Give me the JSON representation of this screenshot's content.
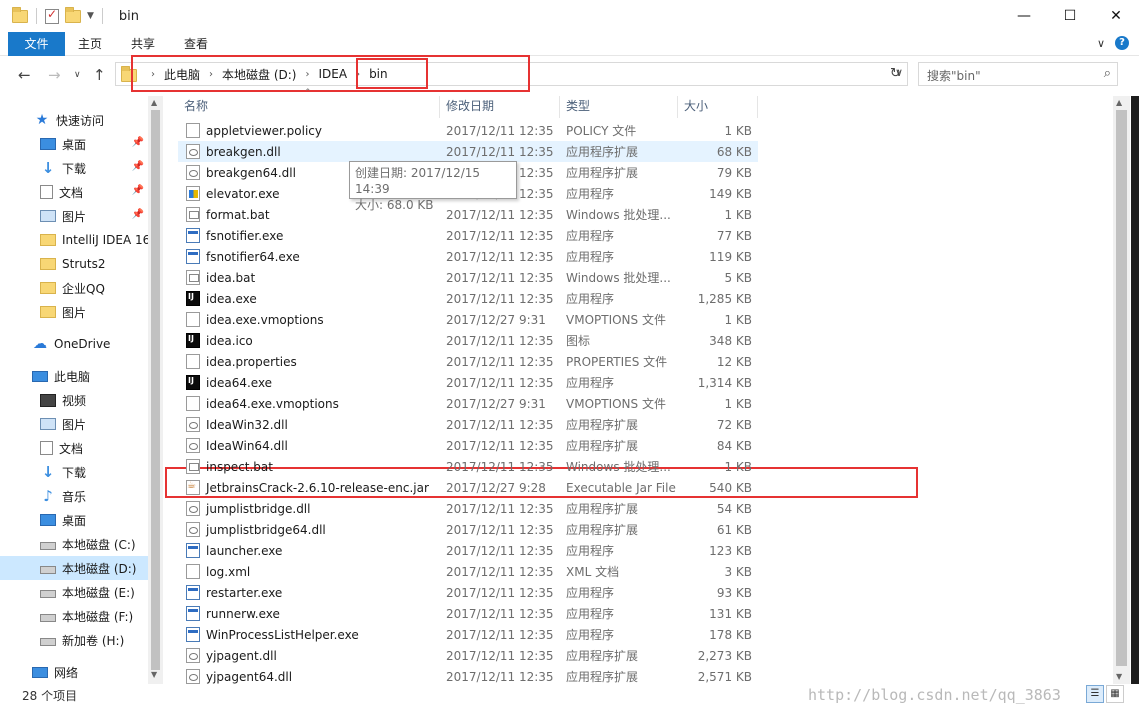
{
  "window": {
    "title": "bin",
    "minimize": "—",
    "maximize": "☐",
    "close": "✕"
  },
  "ribbon": {
    "tabs": [
      "文件",
      "主页",
      "共享",
      "查看"
    ],
    "expand_icon": "chevron-down-icon",
    "help": "?"
  },
  "address": {
    "crumbs": [
      "此电脑",
      "本地磁盘 (D:)",
      "IDEA",
      "bin"
    ],
    "search_placeholder": "搜索\"bin\""
  },
  "sidebar": {
    "items": [
      {
        "label": "快速访问",
        "icon": "star-icon",
        "pinned": false
      },
      {
        "label": "桌面",
        "icon": "desktop-icon",
        "pinned": true
      },
      {
        "label": "下载",
        "icon": "download-icon",
        "pinned": true
      },
      {
        "label": "文档",
        "icon": "document-icon",
        "pinned": true
      },
      {
        "label": "图片",
        "icon": "pictures-icon",
        "pinned": true
      },
      {
        "label": "IntelliJ IDEA 16",
        "icon": "folder-icon",
        "pinned": false
      },
      {
        "label": "Struts2",
        "icon": "folder-icon",
        "pinned": false
      },
      {
        "label": "企业QQ",
        "icon": "folder-icon",
        "pinned": false
      },
      {
        "label": "图片",
        "icon": "folder-icon",
        "pinned": false
      },
      {
        "label": "OneDrive",
        "icon": "cloud-icon",
        "pinned": false
      },
      {
        "label": "此电脑",
        "icon": "computer-icon",
        "pinned": false
      },
      {
        "label": "视频",
        "icon": "video-icon",
        "pinned": false
      },
      {
        "label": "图片",
        "icon": "pictures-icon",
        "pinned": false
      },
      {
        "label": "文档",
        "icon": "document-icon",
        "pinned": false
      },
      {
        "label": "下载",
        "icon": "download-icon",
        "pinned": false
      },
      {
        "label": "音乐",
        "icon": "music-icon",
        "pinned": false
      },
      {
        "label": "桌面",
        "icon": "desktop-icon",
        "pinned": false
      },
      {
        "label": "本地磁盘 (C:)",
        "icon": "drive-icon",
        "pinned": false
      },
      {
        "label": "本地磁盘 (D:)",
        "icon": "drive-icon",
        "pinned": false,
        "selected": true
      },
      {
        "label": "本地磁盘 (E:)",
        "icon": "drive-icon",
        "pinned": false
      },
      {
        "label": "本地磁盘 (F:)",
        "icon": "drive-icon",
        "pinned": false
      },
      {
        "label": "新加卷 (H:)",
        "icon": "drive-icon",
        "pinned": false
      },
      {
        "label": "网络",
        "icon": "network-icon",
        "pinned": false
      }
    ]
  },
  "columns": {
    "name": "名称",
    "date": "修改日期",
    "type": "类型",
    "size": "大小"
  },
  "files": [
    {
      "name": "appletviewer.policy",
      "date": "2017/12/11 12:35",
      "type": "POLICY 文件",
      "size": "1 KB",
      "icon": "file"
    },
    {
      "name": "breakgen.dll",
      "date": "2017/12/11 12:35",
      "type": "应用程序扩展",
      "size": "68 KB",
      "icon": "dll",
      "hover": true
    },
    {
      "name": "breakgen64.dll",
      "date": "2017/12/11 12:35",
      "type": "应用程序扩展",
      "size": "79 KB",
      "icon": "dll"
    },
    {
      "name": "elevator.exe",
      "date": "2017/12/11 12:35",
      "type": "应用程序",
      "size": "149 KB",
      "icon": "elev"
    },
    {
      "name": "format.bat",
      "date": "2017/12/11 12:35",
      "type": "Windows 批处理...",
      "size": "1 KB",
      "icon": "bat"
    },
    {
      "name": "fsnotifier.exe",
      "date": "2017/12/11 12:35",
      "type": "应用程序",
      "size": "77 KB",
      "icon": "exe"
    },
    {
      "name": "fsnotifier64.exe",
      "date": "2017/12/11 12:35",
      "type": "应用程序",
      "size": "119 KB",
      "icon": "exe"
    },
    {
      "name": "idea.bat",
      "date": "2017/12/11 12:35",
      "type": "Windows 批处理...",
      "size": "5 KB",
      "icon": "bat"
    },
    {
      "name": "idea.exe",
      "date": "2017/12/11 12:35",
      "type": "应用程序",
      "size": "1,285 KB",
      "icon": "ij"
    },
    {
      "name": "idea.exe.vmoptions",
      "date": "2017/12/27 9:31",
      "type": "VMOPTIONS 文件",
      "size": "1 KB",
      "icon": "file"
    },
    {
      "name": "idea.ico",
      "date": "2017/12/11 12:35",
      "type": "图标",
      "size": "348 KB",
      "icon": "ij"
    },
    {
      "name": "idea.properties",
      "date": "2017/12/11 12:35",
      "type": "PROPERTIES 文件",
      "size": "12 KB",
      "icon": "file"
    },
    {
      "name": "idea64.exe",
      "date": "2017/12/11 12:35",
      "type": "应用程序",
      "size": "1,314 KB",
      "icon": "ij"
    },
    {
      "name": "idea64.exe.vmoptions",
      "date": "2017/12/27 9:31",
      "type": "VMOPTIONS 文件",
      "size": "1 KB",
      "icon": "file"
    },
    {
      "name": "IdeaWin32.dll",
      "date": "2017/12/11 12:35",
      "type": "应用程序扩展",
      "size": "72 KB",
      "icon": "dll"
    },
    {
      "name": "IdeaWin64.dll",
      "date": "2017/12/11 12:35",
      "type": "应用程序扩展",
      "size": "84 KB",
      "icon": "dll"
    },
    {
      "name": "inspect.bat",
      "date": "2017/12/11 12:35",
      "type": "Windows 批处理...",
      "size": "1 KB",
      "icon": "bat"
    },
    {
      "name": "JetbrainsCrack-2.6.10-release-enc.jar",
      "date": "2017/12/27 9:28",
      "type": "Executable Jar File",
      "size": "540 KB",
      "icon": "jar"
    },
    {
      "name": "jumplistbridge.dll",
      "date": "2017/12/11 12:35",
      "type": "应用程序扩展",
      "size": "54 KB",
      "icon": "dll"
    },
    {
      "name": "jumplistbridge64.dll",
      "date": "2017/12/11 12:35",
      "type": "应用程序扩展",
      "size": "61 KB",
      "icon": "dll"
    },
    {
      "name": "launcher.exe",
      "date": "2017/12/11 12:35",
      "type": "应用程序",
      "size": "123 KB",
      "icon": "exe"
    },
    {
      "name": "log.xml",
      "date": "2017/12/11 12:35",
      "type": "XML 文档",
      "size": "3 KB",
      "icon": "file"
    },
    {
      "name": "restarter.exe",
      "date": "2017/12/11 12:35",
      "type": "应用程序",
      "size": "93 KB",
      "icon": "exe"
    },
    {
      "name": "runnerw.exe",
      "date": "2017/12/11 12:35",
      "type": "应用程序",
      "size": "131 KB",
      "icon": "exe"
    },
    {
      "name": "WinProcessListHelper.exe",
      "date": "2017/12/11 12:35",
      "type": "应用程序",
      "size": "178 KB",
      "icon": "exe"
    },
    {
      "name": "yjpagent.dll",
      "date": "2017/12/11 12:35",
      "type": "应用程序扩展",
      "size": "2,273 KB",
      "icon": "dll"
    },
    {
      "name": "yjpagent64.dll",
      "date": "2017/12/11 12:35",
      "type": "应用程序扩展",
      "size": "2,571 KB",
      "icon": "dll"
    }
  ],
  "tooltip": {
    "created": "创建日期: 2017/12/15 14:39",
    "size": "大小: 68.0 KB"
  },
  "status": {
    "count": "28 个项目"
  },
  "watermark": "http://blog.csdn.net/qq_3863",
  "colors": {
    "accent": "#1979ca",
    "highlight_box": "#e63232",
    "selected_nav": "#cce8ff"
  }
}
